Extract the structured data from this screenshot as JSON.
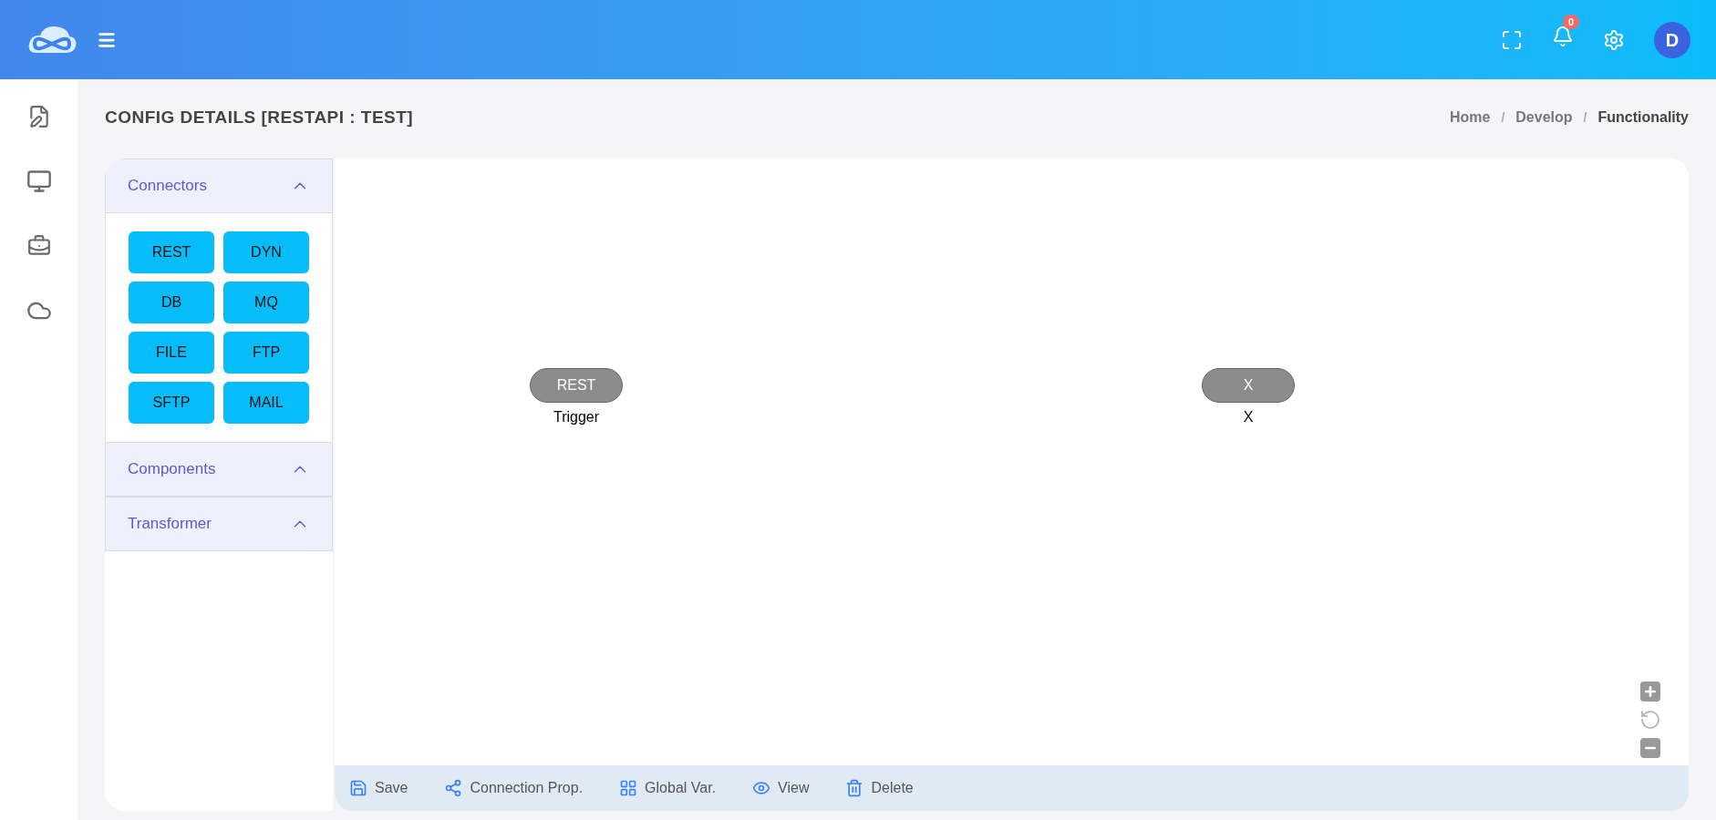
{
  "header": {
    "notification_count": "0",
    "avatar_initial": "D"
  },
  "page_title": "CONFIG DETAILS [RESTAPI : TEST]",
  "breadcrumb": [
    {
      "label": "Home",
      "selected": false
    },
    {
      "separator": "/",
      "label": "Develop",
      "selected": false
    },
    {
      "separator": "/",
      "label": "Functionality",
      "selected": true
    }
  ],
  "palette": [
    {
      "title": "Connectors",
      "items": [
        "REST",
        "DYN",
        "DB",
        "MQ",
        "FILE",
        "FTP",
        "SFTP",
        "MAIL"
      ]
    },
    {
      "title": "Components"
    },
    {
      "title": "Transformer"
    }
  ],
  "canvas": {
    "nodes": [
      {
        "label": "REST",
        "caption": "Trigger"
      },
      {
        "label": "X",
        "caption": "X"
      }
    ]
  },
  "toolbar": [
    {
      "kind": "save",
      "label": "Save"
    },
    {
      "kind": "share",
      "label": "Connection Prop."
    },
    {
      "kind": "grid",
      "label": "Global Var."
    },
    {
      "kind": "view",
      "label": "View"
    },
    {
      "kind": "delete",
      "label": "Delete"
    }
  ]
}
